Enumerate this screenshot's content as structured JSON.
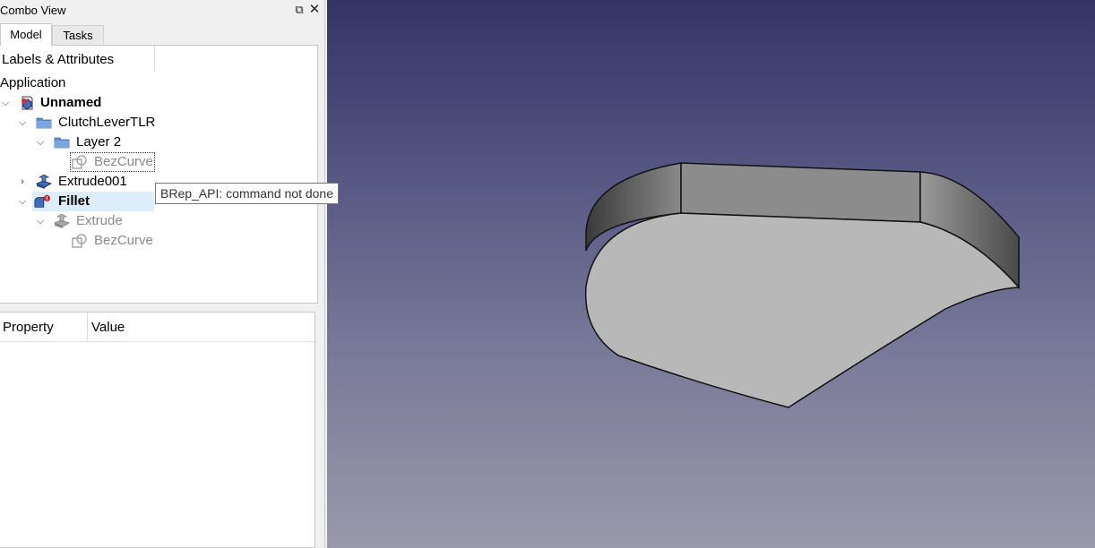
{
  "panel": {
    "title": "Combo View",
    "float_glyph": "⧉",
    "close_glyph": "✕"
  },
  "tabs": [
    {
      "label": "Model",
      "active": true
    },
    {
      "label": "Tasks",
      "active": false
    }
  ],
  "tree": {
    "header": "Labels & Attributes",
    "section": "Application",
    "items": [
      {
        "label": "Unnamed",
        "icon": "document-icon",
        "expanded": true,
        "bold": true
      },
      {
        "label": "ClutchLeverTLR",
        "icon": "folder-icon",
        "expanded": true
      },
      {
        "label": "Layer 2",
        "icon": "folder-icon",
        "expanded": true
      },
      {
        "label": "BezCurve",
        "icon": "sketch-curve-icon",
        "hidden": true,
        "focused": true
      },
      {
        "label": "Extrude001",
        "icon": "extrude-icon",
        "expanded": false
      },
      {
        "label": "Fillet",
        "icon": "fillet-error-icon",
        "expanded": true,
        "bold": true,
        "selected": true
      },
      {
        "label": "Extrude",
        "icon": "extrude-icon",
        "expanded": true,
        "hidden": true
      },
      {
        "label": "BezCurve",
        "icon": "sketch-curve-icon"
      }
    ]
  },
  "tooltip": {
    "text": "BRep_API: command not done"
  },
  "properties": {
    "columns": [
      "Property",
      "Value"
    ]
  },
  "colors": {
    "view_top": "#333366",
    "view_bottom": "#9999aa",
    "selection": "#dceefb",
    "model_face": "#b8b8b8"
  }
}
